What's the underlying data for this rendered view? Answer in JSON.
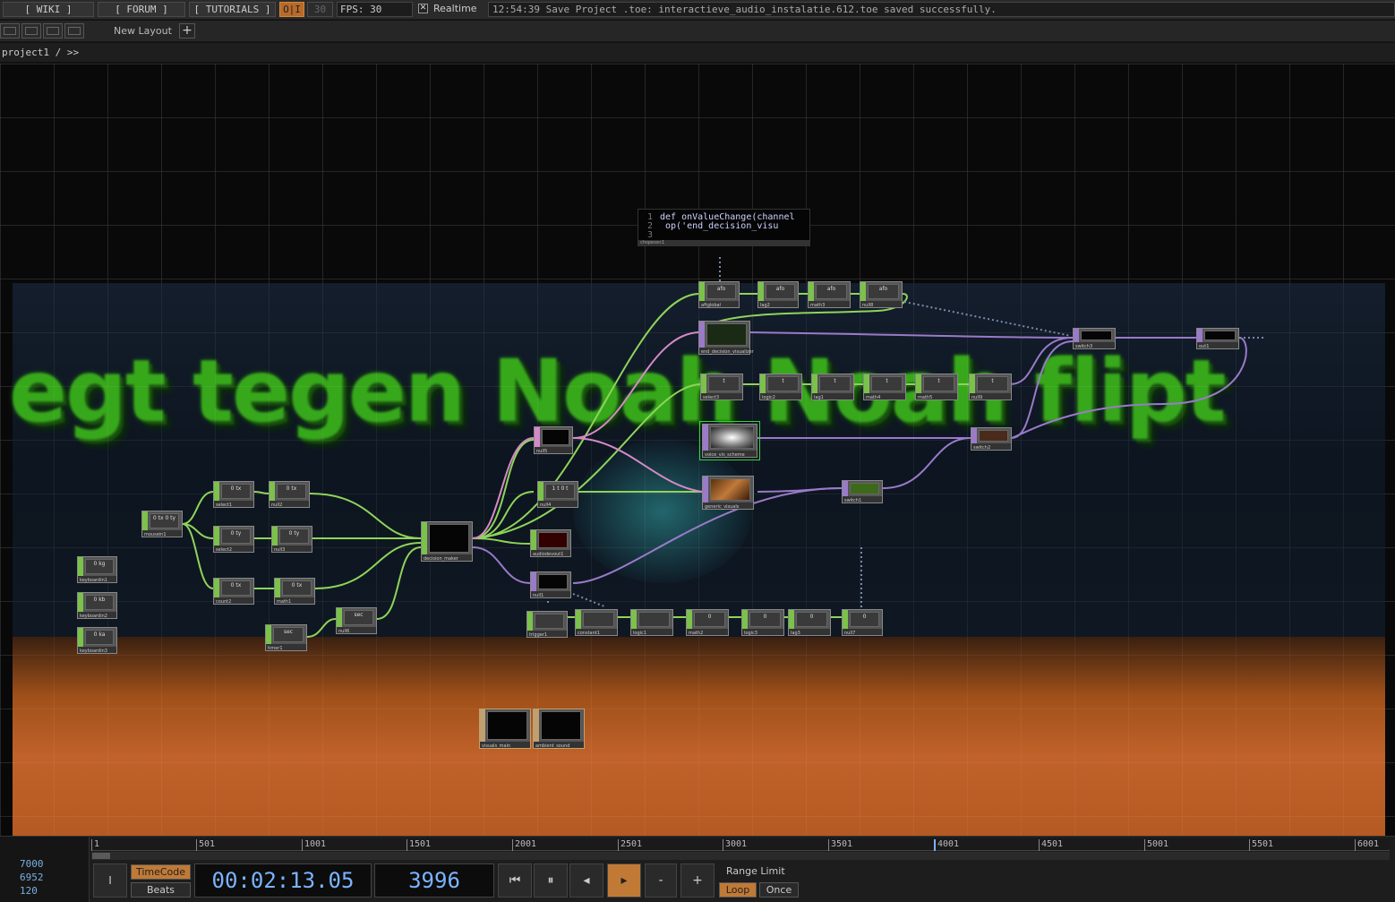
{
  "topbar": {
    "wiki": "[ WIKI ]",
    "forum": "[ FORUM ]",
    "tutorials": "[ TUTORIALS ]",
    "perform_toggle": "O|I",
    "fps_dim": "30",
    "fps_label": "FPS: 30",
    "realtime_check": "✕",
    "realtime_label": "Realtime",
    "status_message": "12:54:39 Save Project .toe: interactieve_audio_instalatie.612.toe saved successfully."
  },
  "layoutbar": {
    "new_layout": "New Layout",
    "plus": "+"
  },
  "pathbar": {
    "path": "project1 / >>"
  },
  "network": {
    "background_text": "egt tegen Noah Noah flipt",
    "code": {
      "line1_num": "1",
      "line1": "def onValueChange(channel",
      "line2_num": "2",
      "line2": "    op('end_decision_visu",
      "line3_num": "3",
      "footer": "chopexec1"
    },
    "nodes": [
      {
        "id": "kb1",
        "label": "keyboardin1",
        "value": "0 kg",
        "type": "chop"
      },
      {
        "id": "kb2",
        "label": "keyboardin2",
        "value": "0 kb",
        "type": "chop"
      },
      {
        "id": "kb3",
        "label": "keyboardin3",
        "value": "0 ka",
        "type": "chop"
      },
      {
        "id": "mouse",
        "label": "mousein1",
        "value": "0 tx 0 ty",
        "type": "chop"
      },
      {
        "id": "sel1",
        "label": "select1",
        "value": "0 tx",
        "type": "chop"
      },
      {
        "id": "sel2",
        "label": "select2",
        "value": "0 ty",
        "type": "chop"
      },
      {
        "id": "count2",
        "label": "count2",
        "value": "0 tx",
        "type": "chop"
      },
      {
        "id": "null2",
        "label": "null2",
        "value": "0 tx",
        "type": "chop"
      },
      {
        "id": "null3",
        "label": "null3",
        "value": "0 ty",
        "type": "chop"
      },
      {
        "id": "math1",
        "label": "math1",
        "value": "0 tx",
        "type": "chop"
      },
      {
        "id": "timer",
        "label": "timer1",
        "value": "sec",
        "type": "chop"
      },
      {
        "id": "null6",
        "label": "null6",
        "value": "sec",
        "type": "chop"
      },
      {
        "id": "decision",
        "label": "decision_maker",
        "value": "",
        "type": "black"
      },
      {
        "id": "null5",
        "label": "null5",
        "value": "",
        "type": "chop"
      },
      {
        "id": "null4",
        "label": "null4",
        "value": "1 t 0 t",
        "type": "chop"
      },
      {
        "id": "audio",
        "label": "audiodevout1",
        "value": "",
        "type": "chop"
      },
      {
        "id": "null1",
        "label": "null1",
        "value": "",
        "type": "top"
      },
      {
        "id": "trig",
        "label": "trigger1",
        "value": "",
        "type": "chop"
      },
      {
        "id": "const",
        "label": "constant1",
        "value": "",
        "type": "chop"
      },
      {
        "id": "logic1",
        "label": "logic1",
        "value": "",
        "type": "chop"
      },
      {
        "id": "math2",
        "label": "math2",
        "value": "0",
        "type": "chop"
      },
      {
        "id": "logic3",
        "label": "logic3",
        "value": "0",
        "type": "chop"
      },
      {
        "id": "lag3",
        "label": "lag3",
        "value": "0",
        "type": "chop"
      },
      {
        "id": "null7",
        "label": "null7",
        "value": "0",
        "type": "chop"
      },
      {
        "id": "aftglobal",
        "label": "aftglobal",
        "value": "afo",
        "type": "chop"
      },
      {
        "id": "lag2",
        "label": "lag2",
        "value": "afo",
        "type": "chop"
      },
      {
        "id": "math3",
        "label": "math3",
        "value": "afo",
        "type": "chop"
      },
      {
        "id": "null8",
        "label": "null8",
        "value": "afo",
        "type": "chop"
      },
      {
        "id": "endvis",
        "label": "end_decision_visualizer",
        "value": "",
        "type": "top"
      },
      {
        "id": "sw3",
        "label": "switch3",
        "value": "",
        "type": "top"
      },
      {
        "id": "out1",
        "label": "out1",
        "value": "",
        "type": "top"
      },
      {
        "id": "sel3",
        "label": "select3",
        "value": "t",
        "type": "chop"
      },
      {
        "id": "logic2",
        "label": "logic2",
        "value": "t",
        "type": "chop"
      },
      {
        "id": "lag1",
        "label": "lag1",
        "value": "t",
        "type": "chop"
      },
      {
        "id": "math4",
        "label": "math4",
        "value": "t",
        "type": "chop"
      },
      {
        "id": "math5",
        "label": "math5",
        "value": "t",
        "type": "chop"
      },
      {
        "id": "null9",
        "label": "null9",
        "value": "t",
        "type": "chop"
      },
      {
        "id": "voice",
        "label": "voice_vis_scheme",
        "value": "",
        "type": "top"
      },
      {
        "id": "sw2",
        "label": "switch2",
        "value": "",
        "type": "top"
      },
      {
        "id": "gen",
        "label": "generic_visuals",
        "value": "",
        "type": "top"
      },
      {
        "id": "sw1",
        "label": "switch1",
        "value": "",
        "type": "top"
      },
      {
        "id": "vis1",
        "label": "visuals_main",
        "value": "",
        "type": "top"
      },
      {
        "id": "vis2",
        "label": "ambient_sound",
        "value": "",
        "type": "top"
      }
    ]
  },
  "timeline": {
    "left_nums": [
      "7000",
      "6952",
      "120"
    ],
    "ruler": [
      "1",
      "501",
      "1001",
      "1501",
      "2001",
      "2501",
      "3001",
      "3501",
      "4001",
      "4501",
      "5001",
      "5501",
      "6001"
    ],
    "mode_i": "I",
    "timecode_label": "TimeCode",
    "beats_label": "Beats",
    "timecode": "00:02:13.05",
    "frame": "3996",
    "rewind": "⏮",
    "pause": "⏸",
    "back": "◂",
    "play": "▸",
    "minus": "-",
    "plus": "+",
    "range_limit": "Range Limit",
    "loop": "Loop",
    "once": "Once"
  },
  "colors": {
    "chop_green": "#7bc24a",
    "top_purple": "#9a7ac9",
    "accent_orange": "#c07a36",
    "timecode_blue": "#7ab4ff"
  }
}
